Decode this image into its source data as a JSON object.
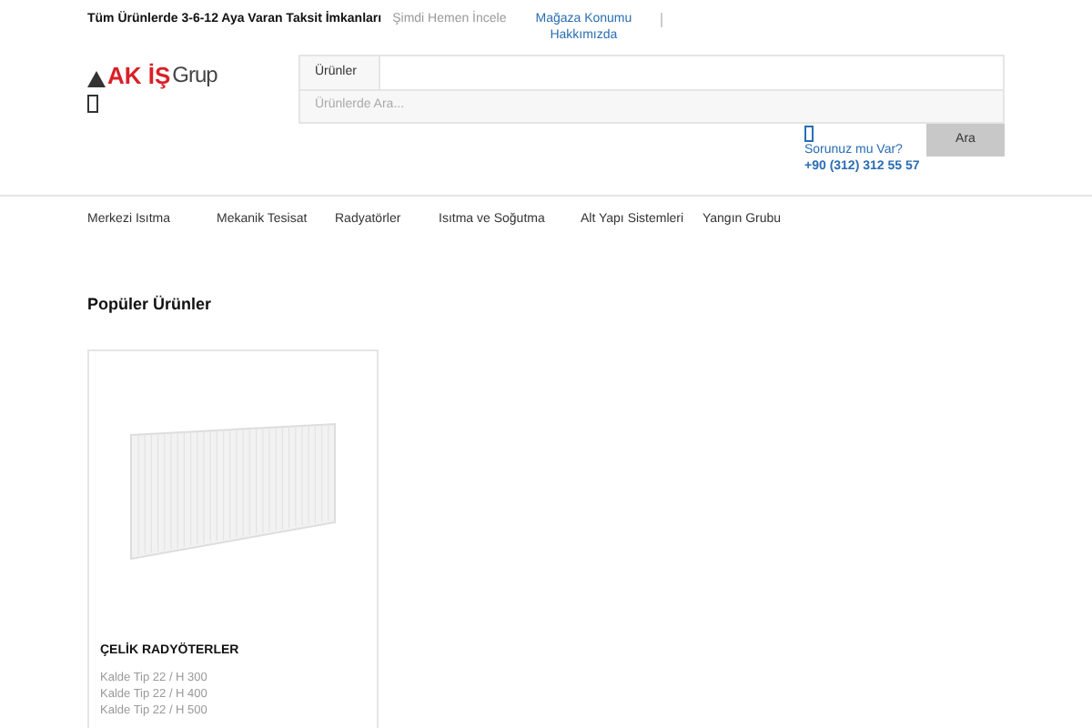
{
  "topbar": {
    "promo": "Tüm Ürünlerde 3-6-12 Aya Varan Taksit İmkanları",
    "promo_link": "Şimdi Hemen İncele",
    "links": [
      "Mağaza Konumu",
      "Hakkımızda"
    ]
  },
  "logo": {
    "mark": "AK İŞ",
    "word": "Grup"
  },
  "search": {
    "category": "Ürünler",
    "placeholder": "Ürünlerde Ara...",
    "button": "Ara"
  },
  "contact": {
    "question": "Sorunuz mu Var?",
    "phone": "+90 (312) 312 55 57"
  },
  "nav": [
    "Merkezi Isıtma",
    "Mekanik Tesisat",
    "Radyatörler",
    "Isıtma ve Soğutma",
    "Alt Yapı Sistemleri",
    "Yangın Grubu"
  ],
  "section_title": "Popüler Ürünler",
  "products": [
    {
      "title": "ÇELİK RADYÖTERLER",
      "items": [
        "Kalde Tip 22 / H 300",
        "Kalde Tip 22 / H 400",
        "Kalde Tip 22 / H 500"
      ]
    }
  ]
}
